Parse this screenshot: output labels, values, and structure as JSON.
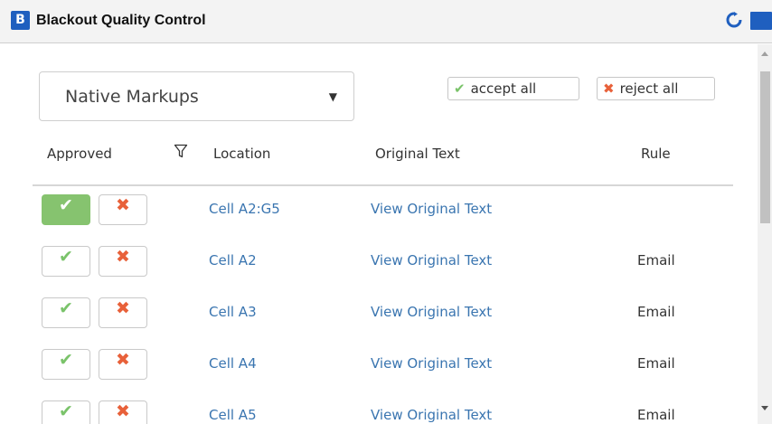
{
  "header": {
    "app_icon_glyph": "B",
    "title": "Blackout Quality Control",
    "icons": [
      "refresh-icon",
      "panel-icon"
    ]
  },
  "toolbar": {
    "dropdown_value": "Native Markups",
    "dropdown_arrow": "▼",
    "accept_all_icon": "✔",
    "accept_all_label": "accept all",
    "reject_all_icon": "✖",
    "reject_all_label": "reject all"
  },
  "table": {
    "columns": [
      "Approved",
      "Location",
      "Original Text",
      "Rule"
    ],
    "approve_glyph": "✔",
    "reject_glyph": "✖",
    "rows": [
      {
        "location": "Cell A2:G5",
        "original": "View Original Text",
        "rule": "",
        "approved": true
      },
      {
        "location": "Cell A2",
        "original": "View Original Text",
        "rule": "Email",
        "approved": false
      },
      {
        "location": "Cell A3",
        "original": "View Original Text",
        "rule": "Email",
        "approved": false
      },
      {
        "location": "Cell A4",
        "original": "View Original Text",
        "rule": "Email",
        "approved": false
      },
      {
        "location": "Cell A5",
        "original": "View Original Text",
        "rule": "Email",
        "approved": false
      }
    ]
  },
  "colors": {
    "accent": "#1f5fbf",
    "approve": "#7ac36a",
    "approve_active_bg": "#86c36f",
    "reject": "#e8613a",
    "link": "#3a75b0"
  }
}
